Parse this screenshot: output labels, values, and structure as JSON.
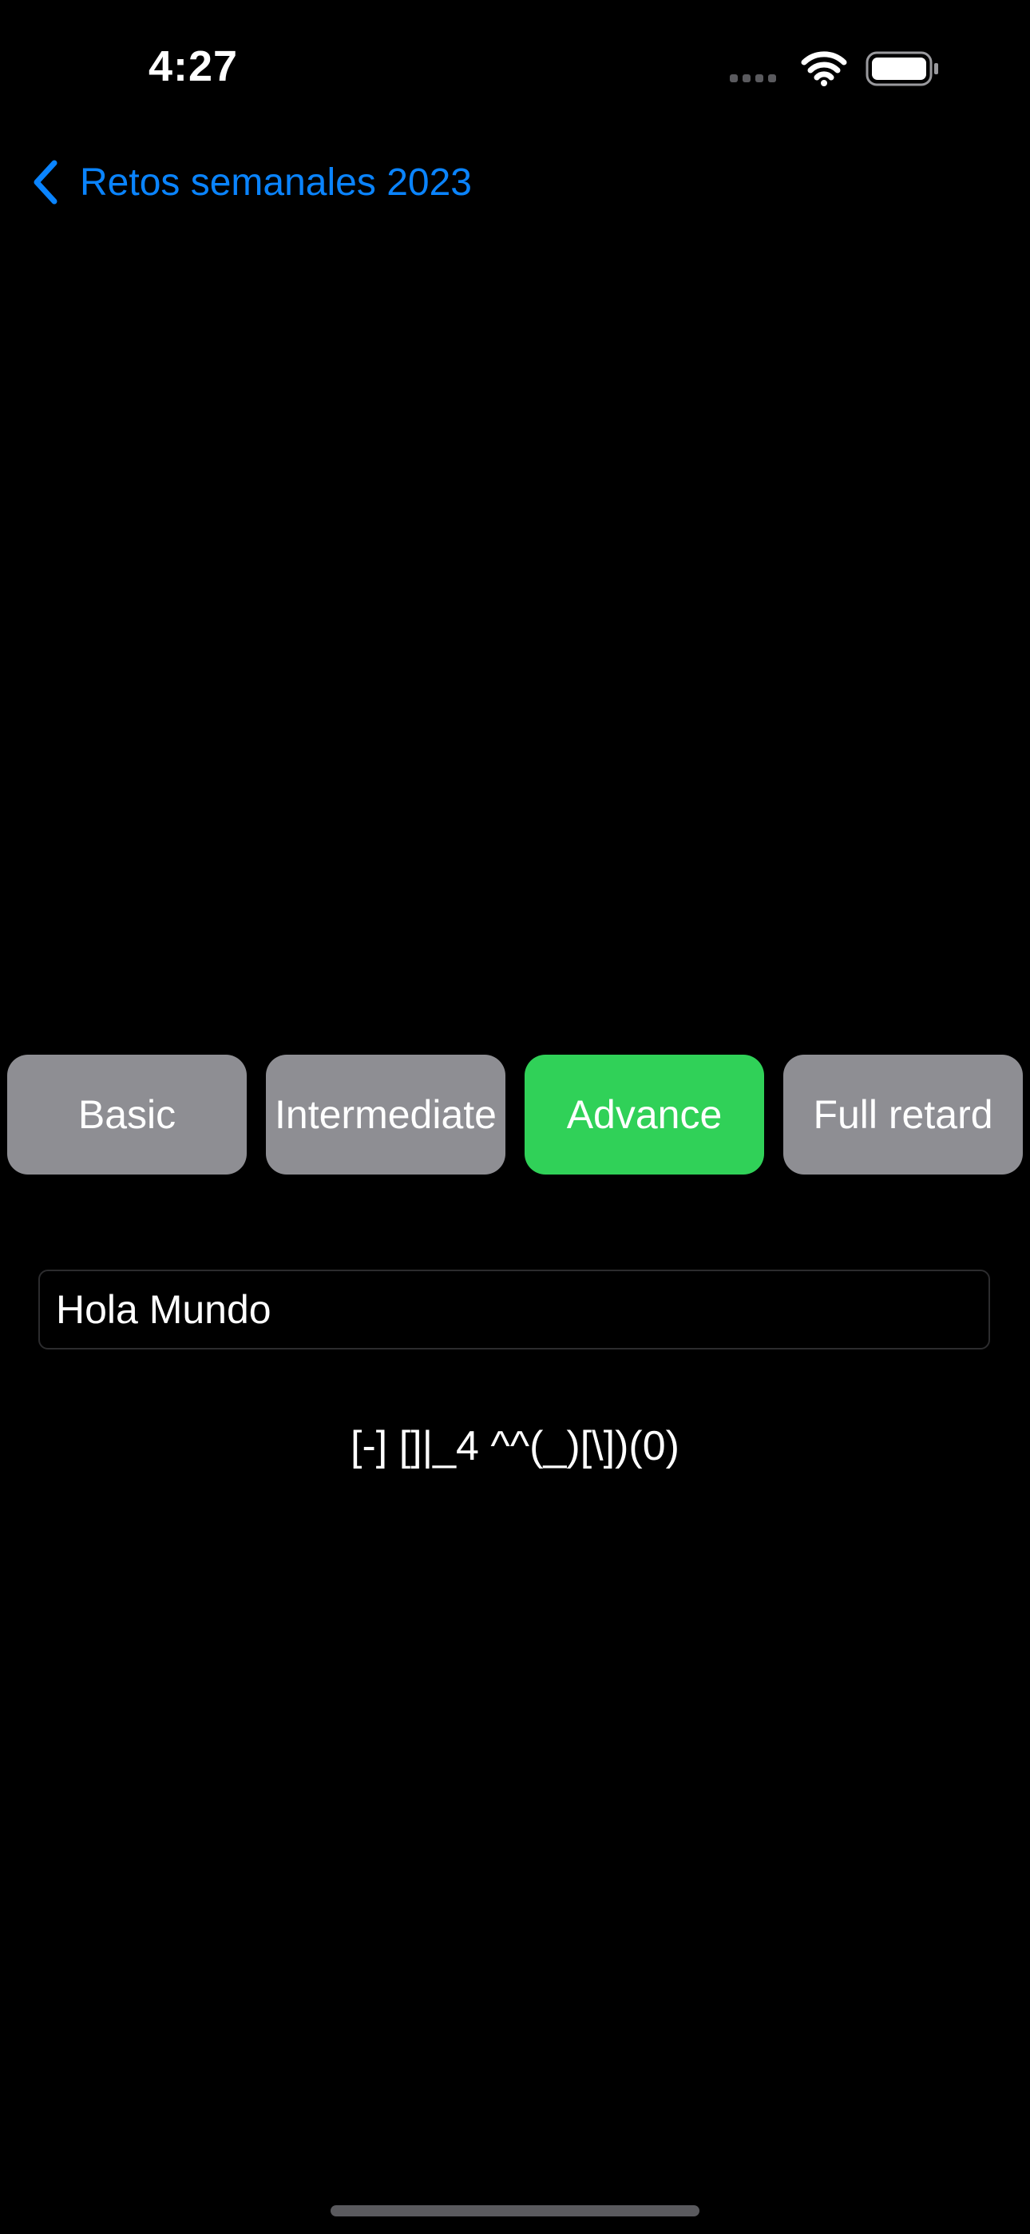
{
  "status_bar": {
    "time": "4:27",
    "icons": [
      "cellular-icon",
      "wifi-icon",
      "battery-icon"
    ]
  },
  "nav": {
    "back_label": "Retos semanales 2023",
    "back_icon": "chevron-left-icon"
  },
  "difficulty": {
    "options": [
      {
        "label": "Basic",
        "selected": false
      },
      {
        "label": "Intermediate",
        "selected": false
      },
      {
        "label": "Advance",
        "selected": true
      },
      {
        "label": "Full retard",
        "selected": false
      }
    ]
  },
  "input": {
    "value": "Hola Mundo"
  },
  "result": {
    "text": "[-] []|_4 ^^(_)[\\])(0)"
  },
  "colors": {
    "background": "#000000",
    "accent": "#0a84ff",
    "selected": "#30d158",
    "unselected": "#8e8e93"
  }
}
